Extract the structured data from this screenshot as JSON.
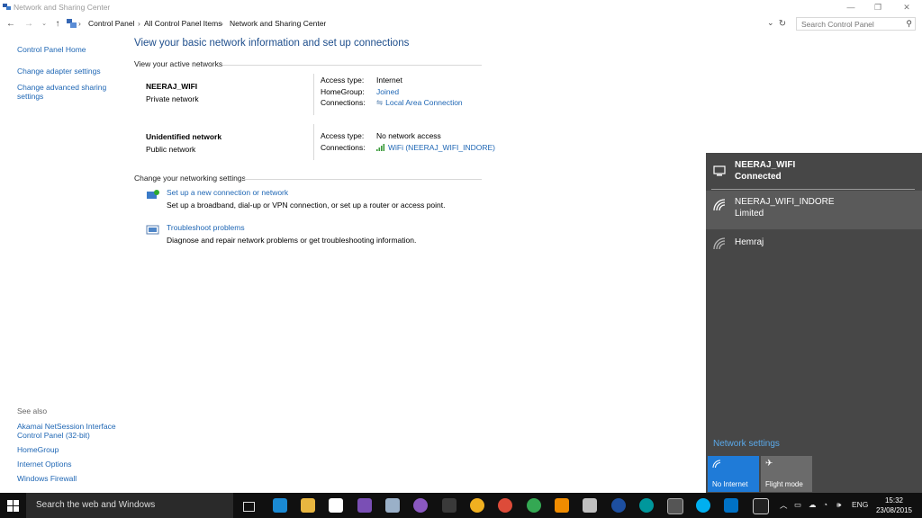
{
  "window": {
    "title": "Network and Sharing Center",
    "controls": {
      "minimize": "—",
      "restore": "❐",
      "close": "✕"
    }
  },
  "address_bar": {
    "breadcrumbs": [
      "Control Panel",
      "All Control Panel Items",
      "Network and Sharing Center"
    ],
    "search_placeholder": "Search Control Panel"
  },
  "left_pane": {
    "items": [
      "Control Panel Home",
      "Change adapter settings",
      "Change advanced sharing settings"
    ]
  },
  "see_also": {
    "header": "See also",
    "items": [
      "Akamai NetSession Interface Control Panel (32-bit)",
      "HomeGroup",
      "Internet Options",
      "Windows Firewall"
    ]
  },
  "main": {
    "heading": "View your basic network information and set up connections",
    "active_networks_label": "View your active networks",
    "networks": [
      {
        "name": "NEERAJ_WIFI",
        "type": "Private network",
        "props": [
          {
            "key": "Access type:",
            "value": "Internet",
            "link": false
          },
          {
            "key": "HomeGroup:",
            "value": "Joined",
            "link": true
          },
          {
            "key": "Connections:",
            "value": "Local Area Connection",
            "link": true
          }
        ]
      },
      {
        "name": "Unidentified network",
        "type": "Public network",
        "props": [
          {
            "key": "Access type:",
            "value": "No network access",
            "link": false
          },
          {
            "key": "Connections:",
            "value": "WiFi (NEERAJ_WIFI_INDORE)",
            "link": true
          }
        ]
      }
    ],
    "change_settings_label": "Change your networking settings",
    "tasks": [
      {
        "link": "Set up a new connection or network",
        "desc": "Set up a broadband, dial-up or VPN connection, or set up a router or access point."
      },
      {
        "link": "Troubleshoot problems",
        "desc": "Diagnose and repair network problems or get troubleshooting information."
      }
    ]
  },
  "flyout": {
    "connections": [
      {
        "name": "NEERAJ_WIFI",
        "status": "Connected"
      },
      {
        "name": "NEERAJ_WIFI_INDORE",
        "status": "Limited"
      },
      {
        "name": "Hemraj",
        "status": ""
      }
    ],
    "network_settings": "Network settings",
    "tiles": [
      {
        "label": "No Internet",
        "color": "#1f7bd8"
      },
      {
        "label": "Flight mode",
        "color": "#6b6b6b"
      }
    ]
  },
  "taskbar": {
    "search_placeholder": "Search the web and Windows",
    "language": "ENG",
    "time": "15:32",
    "date": "23/08/2015",
    "pinned_icons": [
      "task-view-icon",
      "edge-icon",
      "file-explorer-icon",
      "store-icon",
      "viber-icon",
      "photos-icon",
      "picasa-icon",
      "app-icon",
      "chrome-icon",
      "maps-icon",
      "vlc-icon",
      "calculator-icon",
      "browser-icon",
      "arduino-icon",
      "snipping-tool-icon",
      "skype-icon",
      "outlook-icon",
      "terminal-icon"
    ]
  },
  "colors": {
    "accent": "#1f7bd8",
    "link": "#1e66b4",
    "flyout_bg": "#474747",
    "taskbar_bg": "#101010"
  }
}
